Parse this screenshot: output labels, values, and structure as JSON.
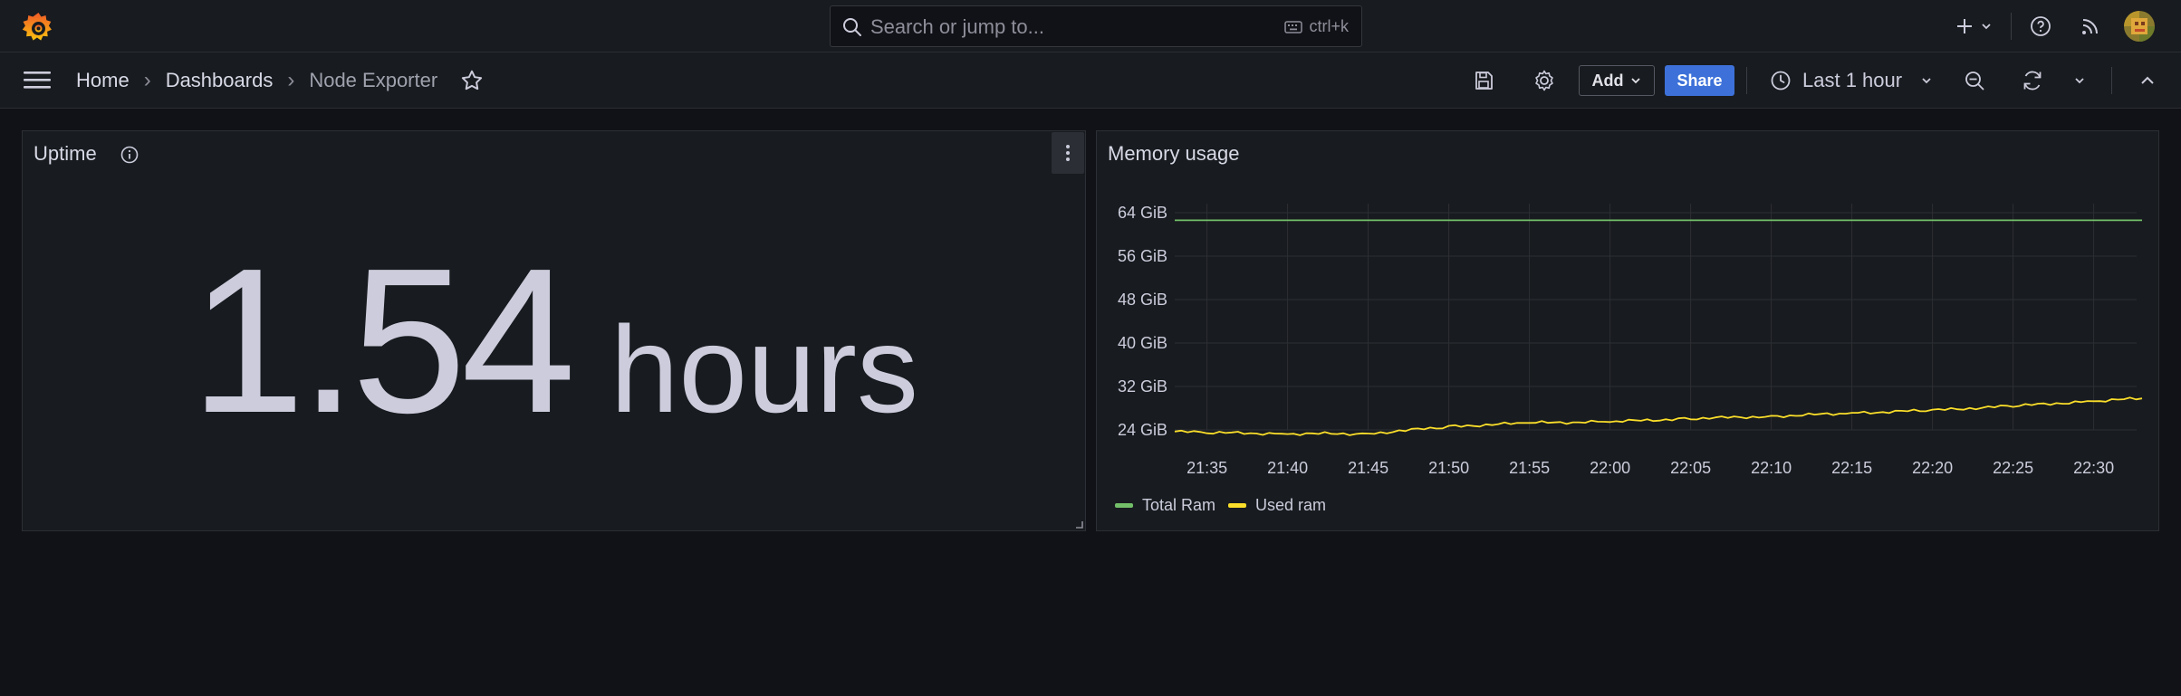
{
  "topbar": {
    "search_placeholder": "Search or jump to...",
    "search_shortcut": "ctrl+k",
    "icons": [
      "grafana-logo",
      "search-icon",
      "keyboard-icon",
      "plus-icon",
      "chevron-down-icon",
      "help-icon",
      "rss-icon",
      "avatar"
    ]
  },
  "breadcrumb": {
    "home": "Home",
    "dashboards": "Dashboards",
    "current": "Node Exporter"
  },
  "toolbar": {
    "add_label": "Add",
    "share_label": "Share",
    "time_range": "Last 1 hour"
  },
  "colors": {
    "accent_blue": "#3d71d9",
    "total_ram": "#73bf69",
    "used_ram": "#fade2a",
    "background": "#111217",
    "panel": "#181b1f"
  },
  "panels": {
    "uptime": {
      "title": "Uptime",
      "value": "1.54",
      "unit": "hours"
    },
    "memory": {
      "title": "Memory usage"
    }
  },
  "chart_data": {
    "type": "line",
    "title": "Memory usage",
    "y_ticks": [
      "64 GiB",
      "56 GiB",
      "48 GiB",
      "40 GiB",
      "32 GiB",
      "24 GiB"
    ],
    "x_ticks": [
      "21:35",
      "21:40",
      "21:45",
      "21:50",
      "21:55",
      "22:00",
      "22:05",
      "22:10",
      "22:15",
      "22:20",
      "22:25",
      "22:30"
    ],
    "ylim": [
      24,
      64
    ],
    "x": [
      "21:33",
      "21:35",
      "21:40",
      "21:45",
      "21:50",
      "21:55",
      "22:00",
      "22:05",
      "22:10",
      "22:15",
      "22:20",
      "22:25",
      "22:30",
      "22:33"
    ],
    "series": [
      {
        "name": "Total Ram",
        "color": "#73bf69",
        "values": [
          62.6,
          62.6,
          62.6,
          62.6,
          62.6,
          62.6,
          62.6,
          62.6,
          62.6,
          62.6,
          62.6,
          62.6,
          62.6,
          62.6
        ]
      },
      {
        "name": "Used ram",
        "color": "#fade2a",
        "values": [
          23.7,
          23.5,
          23.3,
          23.3,
          24.6,
          25.3,
          25.5,
          26.1,
          26.5,
          27.1,
          27.6,
          28.4,
          29.3,
          29.8
        ]
      }
    ],
    "grid": true,
    "legend": "bottom-left"
  }
}
